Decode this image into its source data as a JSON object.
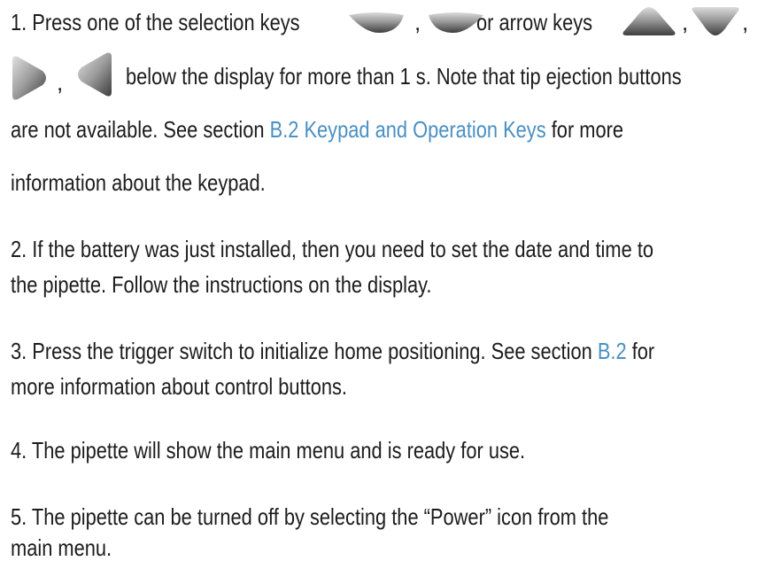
{
  "items": [
    {
      "num": "1.",
      "line1_a": "Press one of the selection keys",
      "comma1": ",",
      "line1_b": "or arrow keys",
      "comma2": ",",
      "comma3": ",",
      "comma4": ",",
      "line2": "below the display for more than 1 s. Note that tip ejection buttons",
      "line3_a": "are not available. See section",
      "line3_link": "B.2 Keypad and Operation Keys",
      "line3_b": "for more",
      "line4": "information about the keypad."
    },
    {
      "num": "2.",
      "line1": "If the battery was just installed, then you need to set the date and time to",
      "line2": "the pipette. Follow the instructions on the display."
    },
    {
      "num": "3.",
      "line1_a": "Press the trigger switch to initialize home positioning. See section",
      "line1_link": "B.2",
      "line1_b": "for",
      "line2": "more information about control buttons."
    },
    {
      "num": "4.",
      "line1": "The pipette will show the main menu and is ready for use."
    },
    {
      "num": "5.",
      "line1": "The pipette can be turned off by selecting the “Power” icon from the",
      "line2": "main menu."
    }
  ],
  "colors": {
    "text": "#1c1c1c",
    "link": "#4a90c2",
    "key_light": "#c9c9c9",
    "key_dark": "#555555"
  },
  "icons": [
    "selection-key-left-icon",
    "selection-key-right-icon",
    "arrow-key-up-icon",
    "arrow-key-down-icon",
    "arrow-key-right-icon",
    "arrow-key-left-icon"
  ]
}
